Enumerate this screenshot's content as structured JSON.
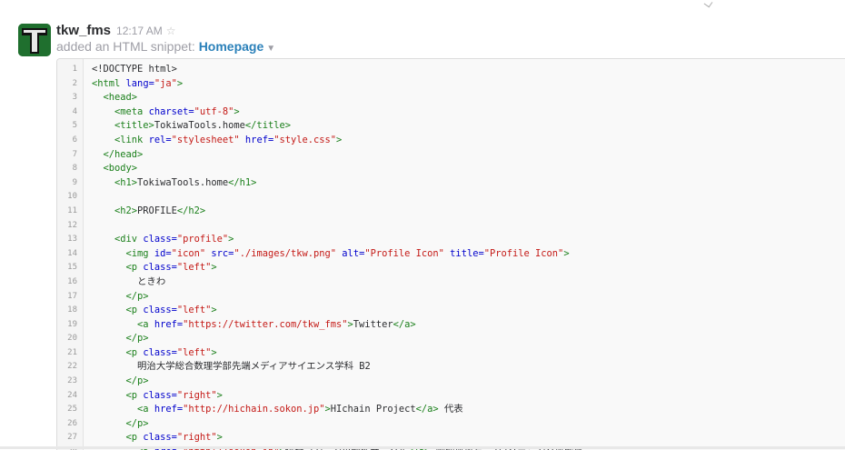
{
  "message": {
    "author": "tkw_fms",
    "time": "12:17 AM",
    "star_icon": "star-outline-icon",
    "action_text": "added an HTML snippet:",
    "snippet_title": "Homepage",
    "caret_icon": "caret-down-icon"
  },
  "colors": {
    "tag": "#1a7f1a",
    "attribute": "#0000cc",
    "string": "#c41a16",
    "link": "#2a80b9",
    "avatar_bg": "#1f6f2e"
  },
  "code_lines": [
    [
      {
        "t": "txt",
        "v": "<!DOCTYPE html>"
      }
    ],
    [
      {
        "t": "tag",
        "v": "<html "
      },
      {
        "t": "attr",
        "v": "lang="
      },
      {
        "t": "str",
        "v": "\"ja\""
      },
      {
        "t": "tag",
        "v": ">"
      }
    ],
    [
      {
        "t": "tag",
        "v": "  <head>"
      }
    ],
    [
      {
        "t": "tag",
        "v": "    <meta "
      },
      {
        "t": "attr",
        "v": "charset="
      },
      {
        "t": "str",
        "v": "\"utf-8\""
      },
      {
        "t": "tag",
        "v": ">"
      }
    ],
    [
      {
        "t": "tag",
        "v": "    <title>"
      },
      {
        "t": "txt",
        "v": "TokiwaTools.home"
      },
      {
        "t": "tag",
        "v": "</title>"
      }
    ],
    [
      {
        "t": "tag",
        "v": "    <link "
      },
      {
        "t": "attr",
        "v": "rel="
      },
      {
        "t": "str",
        "v": "\"stylesheet\""
      },
      {
        "t": "attr",
        "v": " href="
      },
      {
        "t": "str",
        "v": "\"style.css\""
      },
      {
        "t": "tag",
        "v": ">"
      }
    ],
    [
      {
        "t": "tag",
        "v": "  </head>"
      }
    ],
    [
      {
        "t": "tag",
        "v": "  <body>"
      }
    ],
    [
      {
        "t": "tag",
        "v": "    <h1>"
      },
      {
        "t": "txt",
        "v": "TokiwaTools.home"
      },
      {
        "t": "tag",
        "v": "</h1>"
      }
    ],
    [
      {
        "t": "txt",
        "v": ""
      }
    ],
    [
      {
        "t": "tag",
        "v": "    <h2>"
      },
      {
        "t": "txt",
        "v": "PROFILE"
      },
      {
        "t": "tag",
        "v": "</h2>"
      }
    ],
    [
      {
        "t": "txt",
        "v": ""
      }
    ],
    [
      {
        "t": "tag",
        "v": "    <div "
      },
      {
        "t": "attr",
        "v": "class="
      },
      {
        "t": "str",
        "v": "\"profile\""
      },
      {
        "t": "tag",
        "v": ">"
      }
    ],
    [
      {
        "t": "tag",
        "v": "      <img "
      },
      {
        "t": "attr",
        "v": "id="
      },
      {
        "t": "str",
        "v": "\"icon\""
      },
      {
        "t": "attr",
        "v": " src="
      },
      {
        "t": "str",
        "v": "\"./images/tkw.png\""
      },
      {
        "t": "attr",
        "v": " alt="
      },
      {
        "t": "str",
        "v": "\"Profile Icon\""
      },
      {
        "t": "attr",
        "v": " title="
      },
      {
        "t": "str",
        "v": "\"Profile Icon\""
      },
      {
        "t": "tag",
        "v": ">"
      }
    ],
    [
      {
        "t": "tag",
        "v": "      <p "
      },
      {
        "t": "attr",
        "v": "class="
      },
      {
        "t": "str",
        "v": "\"left\""
      },
      {
        "t": "tag",
        "v": ">"
      }
    ],
    [
      {
        "t": "txt",
        "v": "        ときわ"
      }
    ],
    [
      {
        "t": "tag",
        "v": "      </p>"
      }
    ],
    [
      {
        "t": "tag",
        "v": "      <p "
      },
      {
        "t": "attr",
        "v": "class="
      },
      {
        "t": "str",
        "v": "\"left\""
      },
      {
        "t": "tag",
        "v": ">"
      }
    ],
    [
      {
        "t": "tag",
        "v": "        <a "
      },
      {
        "t": "attr",
        "v": "href="
      },
      {
        "t": "str",
        "v": "\"https://twitter.com/tkw_fms\""
      },
      {
        "t": "tag",
        "v": ">"
      },
      {
        "t": "txt",
        "v": "Twitter"
      },
      {
        "t": "tag",
        "v": "</a>"
      }
    ],
    [
      {
        "t": "tag",
        "v": "      </p>"
      }
    ],
    [
      {
        "t": "tag",
        "v": "      <p "
      },
      {
        "t": "attr",
        "v": "class="
      },
      {
        "t": "str",
        "v": "\"left\""
      },
      {
        "t": "tag",
        "v": ">"
      }
    ],
    [
      {
        "t": "txt",
        "v": "        明治大学総合数理学部先端メディアサイエンス学科 B2"
      }
    ],
    [
      {
        "t": "tag",
        "v": "      </p>"
      }
    ],
    [
      {
        "t": "tag",
        "v": "      <p "
      },
      {
        "t": "attr",
        "v": "class="
      },
      {
        "t": "str",
        "v": "\"right\""
      },
      {
        "t": "tag",
        "v": ">"
      }
    ],
    [
      {
        "t": "tag",
        "v": "        <a "
      },
      {
        "t": "attr",
        "v": "href="
      },
      {
        "t": "str",
        "v": "\"http://hichain.sokon.jp\""
      },
      {
        "t": "tag",
        "v": ">"
      },
      {
        "t": "txt",
        "v": "HIchain Project"
      },
      {
        "t": "tag",
        "v": "</a>"
      },
      {
        "t": "txt",
        "v": " 代表"
      }
    ],
    [
      {
        "t": "tag",
        "v": "      </p>"
      }
    ],
    [
      {
        "t": "tag",
        "v": "      <p "
      },
      {
        "t": "attr",
        "v": "class="
      },
      {
        "t": "str",
        "v": "\"right\""
      },
      {
        "t": "tag",
        "v": ">"
      }
    ],
    [
      {
        "t": "tag",
        "v": "        <a "
      },
      {
        "t": "attr",
        "v": "href="
      },
      {
        "t": "str",
        "v": "\"http://sokon.jp\""
      },
      {
        "t": "tag",
        "v": ">"
      },
      {
        "t": "txt",
        "v": "総合コンテンツ制作サークル"
      },
      {
        "t": "tag",
        "v": "</a>"
      },
      {
        "t": "txt",
        "v": " 映像班班長 プログラミング班所属"
      }
    ]
  ]
}
